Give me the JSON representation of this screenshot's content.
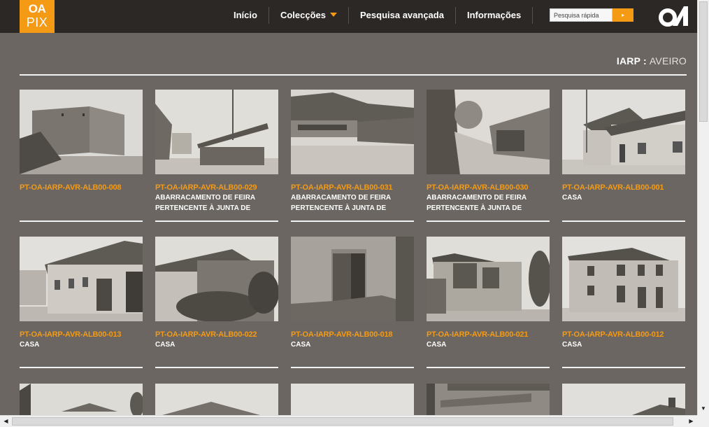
{
  "logo": {
    "line1": "OA",
    "line2": "PIX"
  },
  "nav": {
    "items": [
      {
        "label": "Início"
      },
      {
        "label": "Colecções"
      },
      {
        "label": "Pesquisa avançada"
      },
      {
        "label": "Informações"
      }
    ]
  },
  "search": {
    "placeholder": "Pesquisa rápida",
    "button": "▸"
  },
  "breadcrumb": {
    "collection": "IARP",
    "separator": " : ",
    "region": "AVEIRO"
  },
  "colors": {
    "accent": "#f49a15",
    "background": "#6b6661",
    "topbar": "#2c2826"
  },
  "cards": [
    {
      "code": "PT-OA-IARP-AVR-ALB00-008",
      "desc": ""
    },
    {
      "code": "PT-OA-IARP-AVR-ALB00-029",
      "desc": "ABARRACAMENTO DE FEIRA PERTENCENTE À JUNTA DE FREGUESIA"
    },
    {
      "code": "PT-OA-IARP-AVR-ALB00-031",
      "desc": "ABARRACAMENTO DE FEIRA PERTENCENTE À JUNTA DE FREGUESIA"
    },
    {
      "code": "PT-OA-IARP-AVR-ALB00-030",
      "desc": "ABARRACAMENTO DE FEIRA PERTENCENTE À JUNTA DE FREGUESIA"
    },
    {
      "code": "PT-OA-IARP-AVR-ALB00-001",
      "desc": "CASA"
    },
    {
      "code": "PT-OA-IARP-AVR-ALB00-013",
      "desc": "CASA"
    },
    {
      "code": "PT-OA-IARP-AVR-ALB00-022",
      "desc": "CASA"
    },
    {
      "code": "PT-OA-IARP-AVR-ALB00-018",
      "desc": "CASA"
    },
    {
      "code": "PT-OA-IARP-AVR-ALB00-021",
      "desc": "CASA"
    },
    {
      "code": "PT-OA-IARP-AVR-ALB00-012",
      "desc": "CASA"
    }
  ]
}
